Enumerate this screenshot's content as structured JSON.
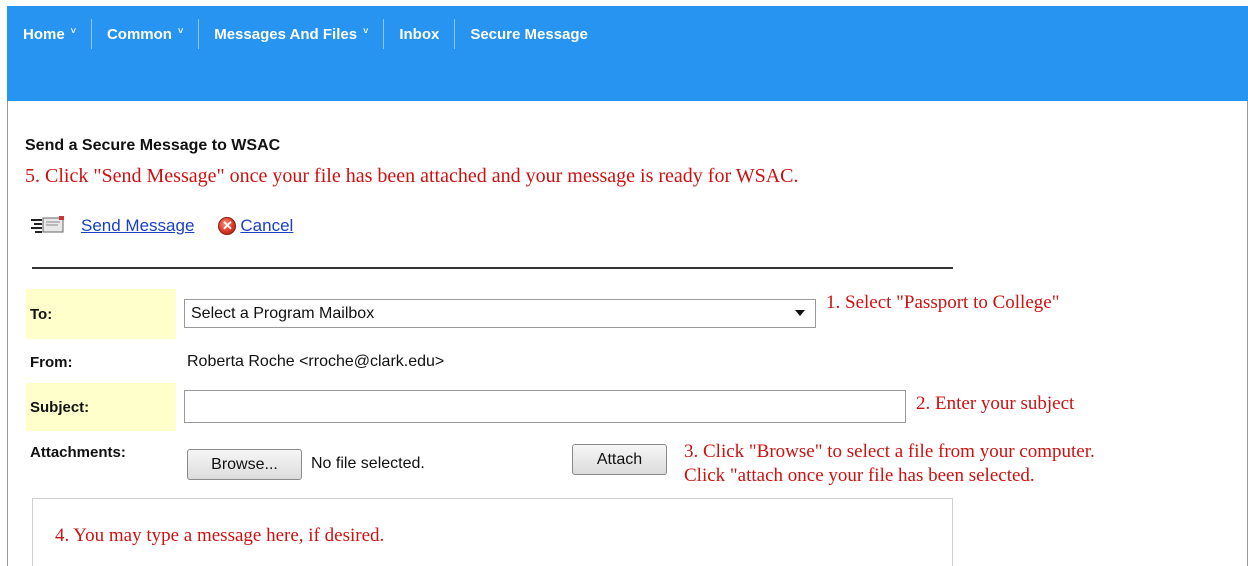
{
  "nav": {
    "items": [
      {
        "label": "Home",
        "chevron": "˅"
      },
      {
        "label": "Common",
        "chevron": "˅"
      },
      {
        "label": "Messages And Files",
        "chevron": "˅"
      },
      {
        "label": "Inbox"
      },
      {
        "label": "Secure Message"
      }
    ]
  },
  "page": {
    "title": "Send a Secure Message to WSAC",
    "instruction_5": "5.  Click \"Send Message\" once your file has been attached and your message is ready for WSAC."
  },
  "actions": {
    "send_label": "Send Message",
    "cancel_label": "Cancel"
  },
  "form": {
    "to_label": "To:",
    "to_select_value": "Select a Program Mailbox",
    "instruction_1": "1. Select \"Passport to College\"",
    "from_label": "From:",
    "from_value": "Roberta Roche <rroche@clark.edu>",
    "subject_label": "Subject:",
    "subject_value": "",
    "instruction_2": "2.  Enter your subject",
    "attachments_label": "Attachments:",
    "browse_label": "Browse...",
    "no_file_text": "No file selected.",
    "attach_label": "Attach",
    "instruction_3a": "3.  Click \"Browse\" to select a file from your computer.",
    "instruction_3b": "Click \"attach once your file has been selected.",
    "instruction_4": "4.  You may type a message here, if desired."
  },
  "colors": {
    "nav_bg": "#2694f0",
    "annotation_red": "#cc1111",
    "label_highlight": "#ffffcc",
    "link_blue": "#1a3fc6"
  }
}
